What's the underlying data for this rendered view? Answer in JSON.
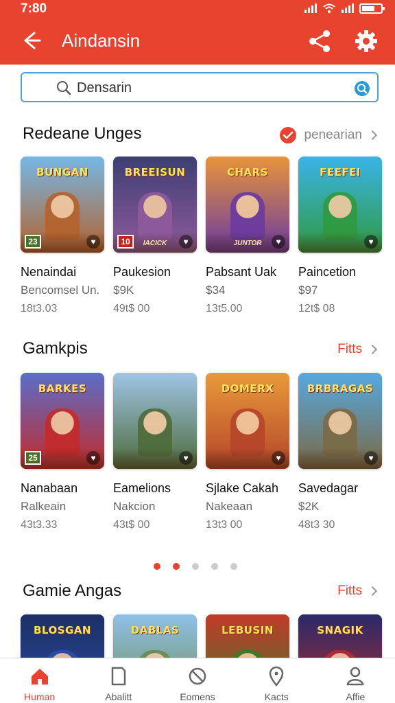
{
  "status_bar": {
    "time": "7:80"
  },
  "app_bar": {
    "title": "Aindansin"
  },
  "search": {
    "value": "Densarin"
  },
  "sections": [
    {
      "title": "Redeane Unges",
      "link": "penearian",
      "cards": [
        {
          "art_title": "BUNGAN",
          "name": "Nenaindai",
          "sub": "Bencomsel Un.",
          "meta": "18t3.03",
          "badge": "23",
          "theme": "#b5622b",
          "sky": "#74b7e6"
        },
        {
          "art_title": "BREEISUN",
          "name": "Paukesion",
          "sub": "$9K",
          "meta": "49t$ 00",
          "badge": "10",
          "caption": "IACICK",
          "theme": "#8f5a9c",
          "sky": "#3d3f73"
        },
        {
          "art_title": "CHARS",
          "name": "Pabsant Uak",
          "sub": "$34",
          "meta": "13t5.00",
          "caption": "JUNTOR",
          "theme": "#6a3aa0",
          "sky": "#e8943a"
        },
        {
          "art_title": "FEEFEI",
          "name": "Paincetion",
          "sub": "$97",
          "meta": "12t$ 08",
          "theme": "#2f9a3e",
          "sky": "#3ab3e8"
        }
      ]
    },
    {
      "title": "Gamkpis",
      "link": "Fitts",
      "cards": [
        {
          "art_title": "BARKES",
          "name": "Nanabaan",
          "sub": "Ralkeain",
          "meta": "43t3.33",
          "badge": "25",
          "theme": "#c42a2a",
          "sky": "#5a6ec9"
        },
        {
          "art_title": "",
          "name": "Eamelions",
          "sub": "Nakcion",
          "meta": "43t$ 00",
          "theme": "#4d6b3a",
          "sky": "#9fc4e6"
        },
        {
          "art_title": "DOMERX",
          "name": "Sjlake Cakah",
          "sub": "Nakeaan",
          "meta": "13t3 00",
          "theme": "#b5452a",
          "sky": "#e89a3a"
        },
        {
          "art_title": "BRBRAGAS",
          "name": "Savedagar",
          "sub": "$2K",
          "meta": "48t3 30",
          "theme": "#7a6a45",
          "sky": "#56a8e0"
        }
      ]
    },
    {
      "title": "Gamie Angas",
      "link": "Fitts",
      "cards": [
        {
          "art_title": "BLOSGAN",
          "theme": "#2b4fa3",
          "sky": "#1d2f66"
        },
        {
          "art_title": "DABLAS",
          "theme": "#6a8a4a",
          "sky": "#8fc0e8"
        },
        {
          "art_title": "LEBUSIN",
          "theme": "#3a7a2a",
          "sky": "#c23a2a"
        },
        {
          "art_title": "SNAGIK",
          "theme": "#b52a2a",
          "sky": "#2a2a6a"
        }
      ]
    }
  ],
  "carousel": {
    "total": 5,
    "active": [
      0,
      1
    ]
  },
  "bottom_nav": [
    {
      "label": "Human",
      "icon": "home-icon",
      "active": true
    },
    {
      "label": "Abalitt",
      "icon": "bookmark-icon",
      "active": false
    },
    {
      "label": "Eomens",
      "icon": "blocked-icon",
      "active": false
    },
    {
      "label": "Kacts",
      "icon": "location-pin-icon",
      "active": false
    },
    {
      "label": "Affie",
      "icon": "profile-icon",
      "active": false
    }
  ],
  "colors": {
    "accent": "#e7432e",
    "search_border": "#4aa3d8",
    "search_icon": "#2a9ad8"
  }
}
